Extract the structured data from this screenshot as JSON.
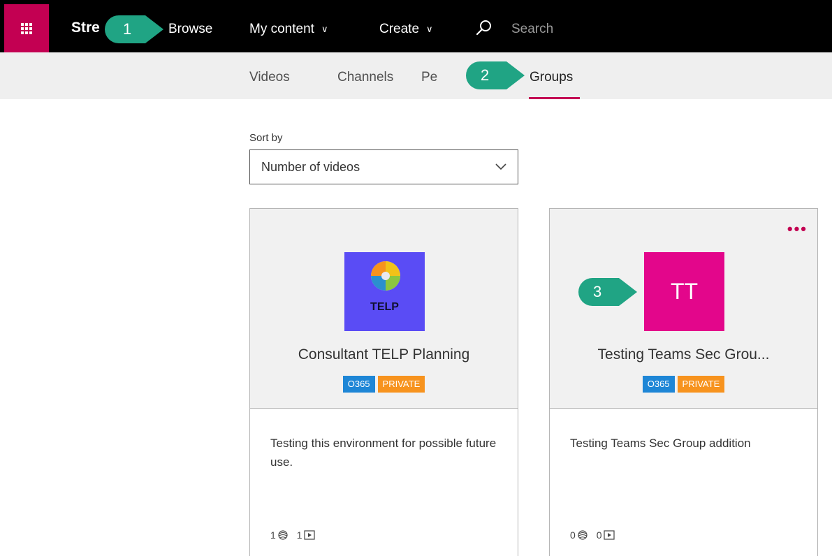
{
  "header": {
    "brand": "Stre",
    "nav": {
      "browse": "Browse",
      "my_content": "My content",
      "create": "Create"
    },
    "search_placeholder": "Search"
  },
  "tabs": {
    "videos": "Videos",
    "channels": "Channels",
    "people": "Pe",
    "groups": "Groups"
  },
  "sort": {
    "label": "Sort by",
    "value": "Number of videos"
  },
  "cards": [
    {
      "logo_text": "TELP",
      "title": "Consultant TELP Planning",
      "badge1": "O365",
      "badge2": "PRIVATE",
      "description": "Testing this environment for possible future use.",
      "channels_count": "1",
      "videos_count": "1"
    },
    {
      "logo_text": "TT",
      "title": "Testing Teams Sec Grou...",
      "badge1": "O365",
      "badge2": "PRIVATE",
      "description": "Testing Teams Sec Group addition",
      "channels_count": "0",
      "videos_count": "0"
    }
  ],
  "callouts": {
    "one": "1",
    "two": "2",
    "three": "3"
  },
  "colors": {
    "accent": "#c30052",
    "callout": "#20a484",
    "o365_badge": "#1e86d6",
    "private_badge": "#f7931e"
  }
}
